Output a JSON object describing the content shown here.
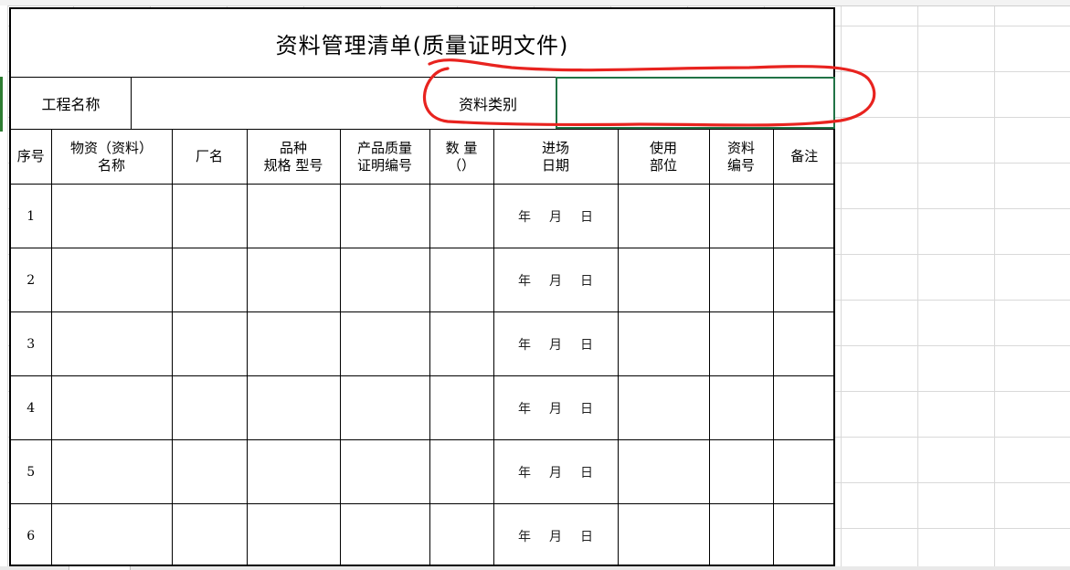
{
  "title": "资料管理清单(质量证明文件)",
  "meta": {
    "project_label": "工程名称",
    "project_value": "",
    "category_label": "资料类别",
    "category_value": ""
  },
  "columns": [
    {
      "key": "seq",
      "label": "序号"
    },
    {
      "key": "material",
      "label": "物资（资料）\n名称"
    },
    {
      "key": "factory",
      "label": "厂名"
    },
    {
      "key": "spec",
      "label": "品种\n规格  型号"
    },
    {
      "key": "cert",
      "label": "产品质量\n证明编号"
    },
    {
      "key": "qty",
      "label": "数  量\n（）"
    },
    {
      "key": "entry_date",
      "label": "进场\n日期"
    },
    {
      "key": "use",
      "label": "使用\n部位"
    },
    {
      "key": "doc_no",
      "label": "资料\n编号"
    },
    {
      "key": "remark",
      "label": "备注"
    }
  ],
  "date_parts": {
    "year": "年",
    "month": "月",
    "day": "日"
  },
  "rows": [
    {
      "seq": "1"
    },
    {
      "seq": "2"
    },
    {
      "seq": "3"
    },
    {
      "seq": "4"
    },
    {
      "seq": "5"
    },
    {
      "seq": "6"
    }
  ],
  "annotation_color": "#e8231f",
  "selection_color": "#217346"
}
